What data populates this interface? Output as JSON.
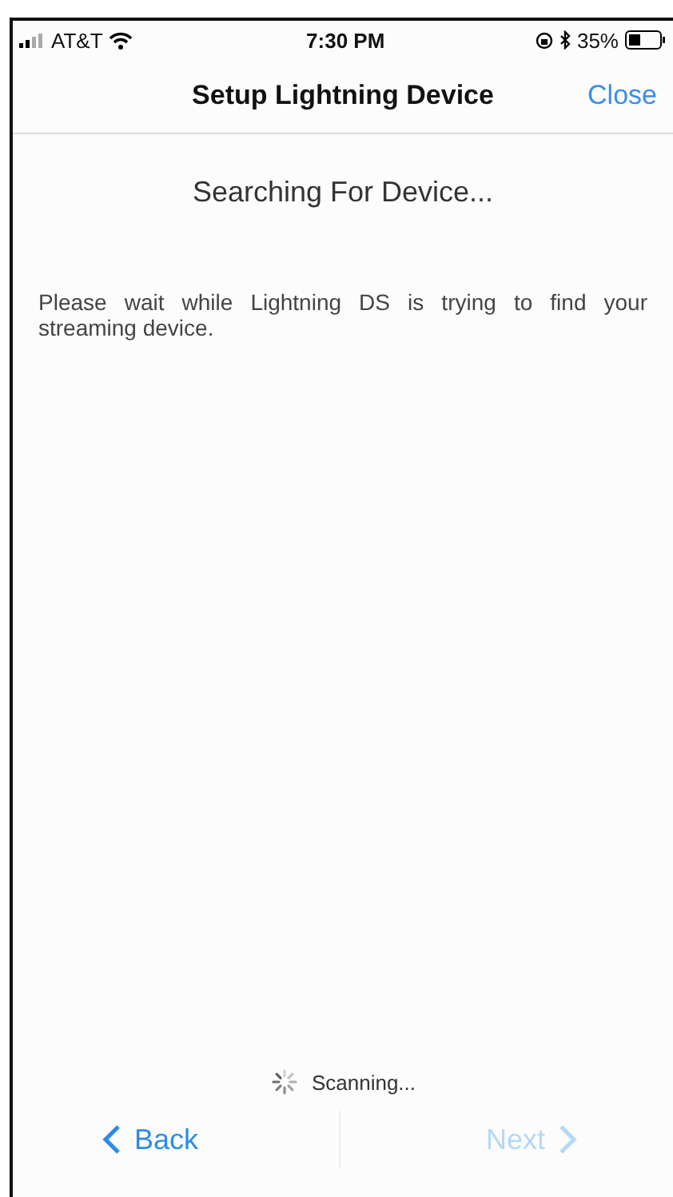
{
  "status_bar": {
    "carrier": "AT&T",
    "time": "7:30 PM",
    "battery_percent": "35%"
  },
  "nav": {
    "title": "Setup Lightning Device",
    "close": "Close"
  },
  "heading": "Searching For Device...",
  "message": "Please wait while Lightning DS is trying to find your streaming device.",
  "progress": {
    "label": "Scanning..."
  },
  "buttons": [
    {
      "label": "Back",
      "kind": "back",
      "disabled": false
    },
    {
      "label": "Next",
      "kind": "next",
      "disabled": true
    }
  ]
}
